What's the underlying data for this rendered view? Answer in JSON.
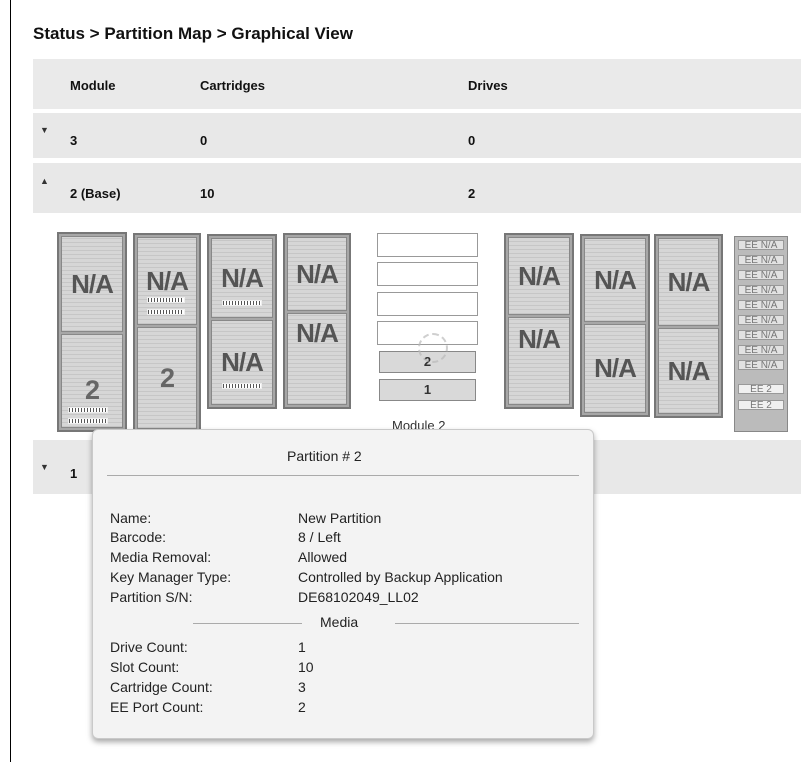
{
  "breadcrumb": "Status > Partition Map > Graphical View",
  "table": {
    "headers": {
      "module": "Module",
      "cartridges": "Cartridges",
      "drives": "Drives"
    },
    "rows": [
      {
        "module": "3",
        "cartridges": "0",
        "drives": "0",
        "expanded": false
      },
      {
        "module": "2 (Base)",
        "cartridges": "10",
        "drives": "2",
        "expanded": true
      },
      {
        "module": "1",
        "cartridges": "",
        "drives": "",
        "expanded": false
      }
    ]
  },
  "module_view": {
    "label": "Module 2",
    "magazines": [
      {
        "top": "N/A",
        "bottom": "2"
      },
      {
        "top": "N/A",
        "bottom": "2"
      },
      {
        "top": "N/A",
        "bottom": "N/A"
      },
      {
        "top": "N/A",
        "bottom": "N/A"
      },
      {
        "top": "N/A",
        "bottom": "N/A"
      },
      {
        "top": "N/A",
        "bottom": "N/A"
      },
      {
        "top": "N/A",
        "bottom": "N/A"
      }
    ],
    "drives": [
      "",
      "",
      "",
      "",
      "2",
      "1"
    ],
    "ee_slots": [
      "EE N/A",
      "EE N/A",
      "EE N/A",
      "EE N/A",
      "EE N/A",
      "EE N/A",
      "EE N/A",
      "EE N/A",
      "EE N/A",
      "EE 2",
      "EE 2"
    ]
  },
  "tooltip": {
    "title": "Partition # 2",
    "name_label": "Name:",
    "name_value": "New Partition",
    "barcode_label": "Barcode:",
    "barcode_value": "8 / Left",
    "media_removal_label": "Media Removal:",
    "media_removal_value": "Allowed",
    "key_manager_label": "Key Manager Type:",
    "key_manager_value": "Controlled by Backup Application",
    "partition_sn_label": "Partition S/N:",
    "partition_sn_value": "DE68102049_LL02",
    "media_heading": "Media",
    "drive_count_label": "Drive Count:",
    "drive_count_value": "1",
    "slot_count_label": "Slot Count:",
    "slot_count_value": "10",
    "cartridge_count_label": "Cartridge Count:",
    "cartridge_count_value": "3",
    "ee_port_count_label": "EE Port Count:",
    "ee_port_count_value": "2"
  }
}
